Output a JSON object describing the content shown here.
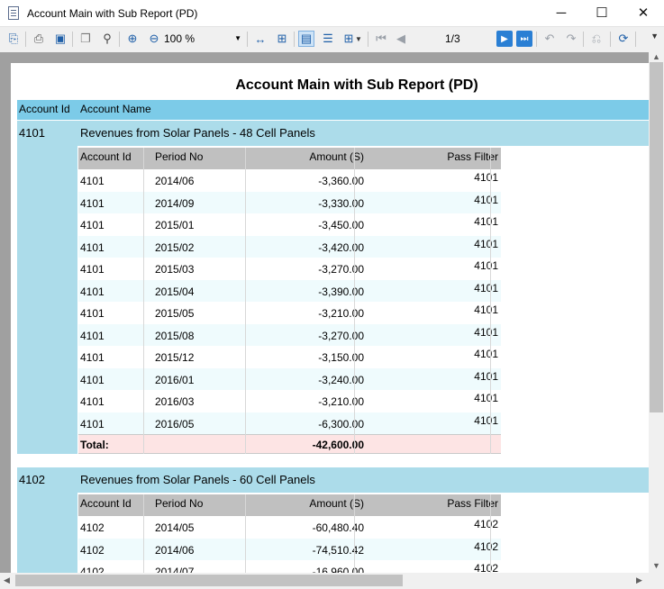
{
  "window": {
    "title": "Account Main with Sub Report (PD)",
    "controls": {
      "minimize": "─",
      "maximize": "☐",
      "close": "✕"
    }
  },
  "toolbar": {
    "zoom_value": "100 %",
    "page_indicator": "1/3",
    "icons": [
      "copy-icon",
      "print-icon",
      "print-preview-icon",
      "copy-pages-icon",
      "find-icon",
      "zoom-in-icon",
      "zoom-out-icon",
      "fit-width-icon",
      "fit-page-icon",
      "single-page-icon",
      "continuous-icon",
      "multi-page-icon",
      "first-page-icon",
      "prev-page-icon",
      "next-page-icon",
      "last-page-icon",
      "back-icon",
      "forward-icon",
      "undo-icon",
      "refresh-icon"
    ]
  },
  "report": {
    "title": "Account Main with Sub Report (PD)",
    "headers": {
      "account_id": "Account Id",
      "account_name": "Account Name"
    },
    "sub_headers": {
      "account_id": "Account Id",
      "period_no": "Period No",
      "amount": "Amount (S)",
      "pass_filter": "Pass Filter"
    },
    "groups": [
      {
        "account_id": "4101",
        "account_name": "Revenues from Solar Panels - 48 Cell Panels",
        "rows": [
          {
            "account_id": "4101",
            "period": "2014/06",
            "amount": "-3,360.00",
            "pass": "4101"
          },
          {
            "account_id": "4101",
            "period": "2014/09",
            "amount": "-3,330.00",
            "pass": "4101"
          },
          {
            "account_id": "4101",
            "period": "2015/01",
            "amount": "-3,450.00",
            "pass": "4101"
          },
          {
            "account_id": "4101",
            "period": "2015/02",
            "amount": "-3,420.00",
            "pass": "4101"
          },
          {
            "account_id": "4101",
            "period": "2015/03",
            "amount": "-3,270.00",
            "pass": "4101"
          },
          {
            "account_id": "4101",
            "period": "2015/04",
            "amount": "-3,390.00",
            "pass": "4101"
          },
          {
            "account_id": "4101",
            "period": "2015/05",
            "amount": "-3,210.00",
            "pass": "4101"
          },
          {
            "account_id": "4101",
            "period": "2015/08",
            "amount": "-3,270.00",
            "pass": "4101"
          },
          {
            "account_id": "4101",
            "period": "2015/12",
            "amount": "-3,150.00",
            "pass": "4101"
          },
          {
            "account_id": "4101",
            "period": "2016/01",
            "amount": "-3,240.00",
            "pass": "4101"
          },
          {
            "account_id": "4101",
            "period": "2016/03",
            "amount": "-3,210.00",
            "pass": "4101"
          },
          {
            "account_id": "4101",
            "period": "2016/05",
            "amount": "-6,300.00",
            "pass": "4101"
          }
        ],
        "total_label": "Total:",
        "total_amount": "-42,600.00"
      },
      {
        "account_id": "4102",
        "account_name": "Revenues from Solar Panels - 60 Cell Panels",
        "rows": [
          {
            "account_id": "4102",
            "period": "2014/05",
            "amount": "-60,480.40",
            "pass": "4102"
          },
          {
            "account_id": "4102",
            "period": "2014/06",
            "amount": "-74,510.42",
            "pass": "4102"
          },
          {
            "account_id": "4102",
            "period": "2014/07",
            "amount": "-16,960.00",
            "pass": "4102"
          }
        ]
      }
    ]
  }
}
